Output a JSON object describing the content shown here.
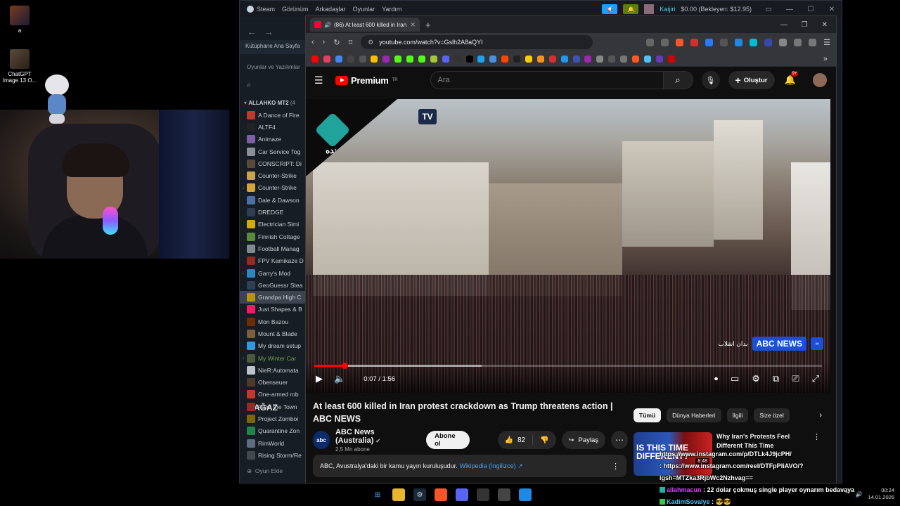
{
  "desktop": {
    "icons": [
      {
        "label": "a"
      },
      {
        "label": "ChatGPT Image 13 O..."
      }
    ]
  },
  "steam": {
    "menu": [
      "Steam",
      "Görünüm",
      "Arkadaşlar",
      "Oyunlar",
      "Yardım"
    ],
    "user": "Kaijiri",
    "wallet": "$0.00 (Bekleyen: $12.95)",
    "nav_title": "MAĞAZ",
    "library_home": "Kütüphane Ana Sayfa",
    "filter_label": "Oyunlar ve Yazılımlar",
    "section_title": "ALLAHKO MT2",
    "section_count": "(4",
    "games": [
      {
        "name": "A Dance of Fire",
        "color": "#c0392b",
        "dl": ""
      },
      {
        "name": "ALTF4",
        "color": "#222",
        "dl": ""
      },
      {
        "name": "Animaze",
        "color": "#7d5fa8",
        "dl": ""
      },
      {
        "name": "Car Service Tog",
        "color": "#8a8f98",
        "dl": ""
      },
      {
        "name": "CONSCRIPT: Di",
        "color": "#5a4a3a",
        "dl": ""
      },
      {
        "name": "Counter-Strike",
        "color": "#c9a24a",
        "dl": ""
      },
      {
        "name": "Counter-Strike",
        "color": "#d4a43a",
        "dl": "↓"
      },
      {
        "name": "Dale & Dawson",
        "color": "#4a6fa5",
        "dl": ""
      },
      {
        "name": "DREDGE",
        "color": "#2c3e50",
        "dl": ""
      },
      {
        "name": "Electrician Simi",
        "color": "#d4ac0d",
        "dl": ""
      },
      {
        "name": "Finnish Cottage",
        "color": "#5b8a3a",
        "dl": ""
      },
      {
        "name": "Football Manag",
        "color": "#7f8c8d",
        "dl": ""
      },
      {
        "name": "FPV Kamikaze D",
        "color": "#922b21",
        "dl": ""
      },
      {
        "name": "Garry's Mod",
        "color": "#2e86c1",
        "dl": "↓"
      },
      {
        "name": "GeoGuessr Stea",
        "color": "#2e4053",
        "dl": ""
      },
      {
        "name": "Grandpa High C",
        "color": "#b7950b",
        "dl": "",
        "selected": true
      },
      {
        "name": "Just Shapes & B",
        "color": "#e91e63",
        "dl": ""
      },
      {
        "name": "Mon Bazou",
        "color": "#6e2c00",
        "dl": ""
      },
      {
        "name": "Mount & Blade",
        "color": "#7b5e3c",
        "dl": ""
      },
      {
        "name": "My dream setup",
        "color": "#3498db",
        "dl": ""
      },
      {
        "name": "My Winter Car",
        "color": "#4a5a3a",
        "dl": "↓",
        "green": true
      },
      {
        "name": "NieR:Automata",
        "color": "#bdc3c7",
        "dl": ""
      },
      {
        "name": "Obenseuer",
        "color": "#4d3b2a",
        "dl": ""
      },
      {
        "name": "One-armed rob",
        "color": "#c0392b",
        "dl": ""
      },
      {
        "name": "Paint the Town",
        "color": "#922b21",
        "dl": ""
      },
      {
        "name": "Project Zomboi",
        "color": "#7d6608",
        "dl": ""
      },
      {
        "name": "Quarantine Zon",
        "color": "#1e8449",
        "dl": ""
      },
      {
        "name": "RimWorld",
        "color": "#5d6d7e",
        "dl": ""
      },
      {
        "name": "Rising Storm/Re",
        "color": "#424949",
        "dl": ""
      }
    ],
    "add_game": "Oyun Ekle"
  },
  "browser": {
    "tab_title": "(86) At least 600 killed in Iran",
    "url": "youtube.com/watch?v=Gslh2A8aQYI"
  },
  "youtube": {
    "logo": "Premium",
    "logo_sup": "TR",
    "search_placeholder": "Ara",
    "create": "Oluştur",
    "notif_count": "9+",
    "video": {
      "channel_bug_live": "زنده",
      "tv_badge": "TV",
      "abc_bug_text": "ABC NEWS",
      "abc_bug_fa": "بدان انقلاب",
      "time": "0:07 / 1:56",
      "progress": 0.06,
      "buffered": 0.33
    },
    "title": "At least 600 killed in Iran protest crackdown as Trump threatens action | ABC NEWS",
    "channel": {
      "name": "ABC News (Australia)",
      "avatar_text": "abc",
      "subs": "2,5 Mn abone"
    },
    "subscribe": "Abone ol",
    "likes": "82",
    "share": "Paylaş",
    "description": "ABC, Avustralya'daki bir kamu yayın kuruluşudur.",
    "description_link": "Wikipedia (İngilizce) ↗",
    "chips": [
      "Tümü",
      "Dünya Haberleri",
      "İlgili",
      "Size özel"
    ],
    "rec": {
      "title": "Why Iran's Protests Feel Different This Time",
      "thumb_text": "IS THIS TIME DIFFERENT?",
      "duration": "8:48"
    }
  },
  "chat": [
    {
      "user": "",
      "text": "https://www.instagram.com/p/DTLk4J9jcPH/"
    },
    {
      "user": "",
      "text": ": https://www.instagram.com/reel/DTFpPliAVO/?"
    },
    {
      "user": "",
      "text": "igsh=MTZka3RjbWc2Nzhvag=="
    },
    {
      "user": "allahmacun",
      "text": ": 22 dolar çokmuş single player oynarım bedavaya"
    },
    {
      "user": "KadimSovalye",
      "text": ": 😎😎"
    }
  ],
  "taskbar": {
    "time": "00:24",
    "date": "14.01.2026"
  }
}
